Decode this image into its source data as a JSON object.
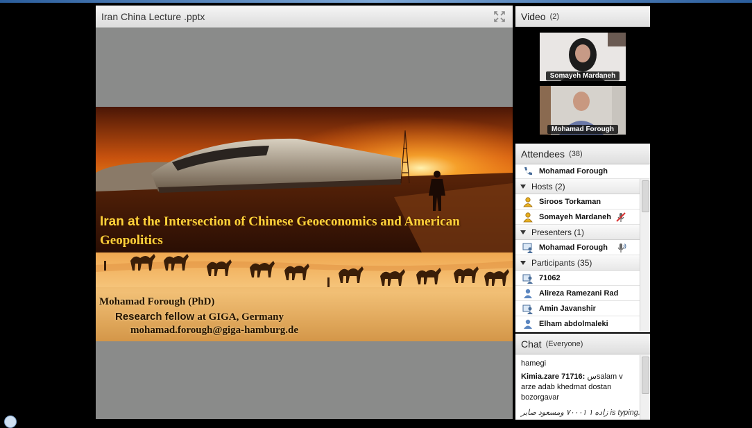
{
  "share": {
    "title": "Iran China Lecture .pptx",
    "slide": {
      "title_lead": "Iran at",
      "title_rest": "the Intersection of Chinese Geoeconomics and American Geopolitics",
      "author_name": "Mohamad Forough (PhD)",
      "author_role_lead": "Research fellow",
      "author_role_rest": "at GIGA, Germany",
      "author_email": "mohamad.forough@giga-hamburg.de"
    }
  },
  "video": {
    "title": "Video",
    "count": "(2)",
    "participants": [
      {
        "name": "Somayeh Mardaneh"
      },
      {
        "name": "Mohamad Forough"
      }
    ]
  },
  "attendees": {
    "title": "Attendees",
    "count": "(38)",
    "self": {
      "name": "Mohamad Forough",
      "icon": "phone-icon"
    },
    "hosts_label": "Hosts (2)",
    "hosts": [
      {
        "name": "Siroos Torkaman",
        "icon": "host-user-icon"
      },
      {
        "name": "Somayeh Mardaneh",
        "icon": "host-user-icon",
        "status_icon": "mic-muted-icon"
      }
    ],
    "presenters_label": "Presenters (1)",
    "presenters": [
      {
        "name": "Mohamad Forough",
        "icon": "presenter-icon",
        "status_icon": "mic-active-icon"
      }
    ],
    "participants_label": "Participants (35)",
    "participants": [
      {
        "name": "71062",
        "icon": "participant-video-icon"
      },
      {
        "name": "Alireza Ramezani Rad",
        "icon": "participant-icon"
      },
      {
        "name": "Amin Javanshir",
        "icon": "participant-video-icon"
      },
      {
        "name": "Elham abdolmaleki",
        "icon": "participant-icon"
      }
    ]
  },
  "chat": {
    "title": "Chat",
    "scope": "(Everyone)",
    "messages": [
      {
        "text": "hamegi"
      },
      {
        "sender": "Kimia.zare 71716:",
        "text": "سsalam v arze adab khedmat dostan bozorgavar"
      }
    ],
    "typing": "زاده ۱ ۷۰۰۰۱ ومسعود صابر is typing..."
  },
  "colors": {
    "accent": "#2a5d9c",
    "slide_title": "#ffd23a",
    "host_icon": "#e8b020",
    "muted_red": "#d83030"
  }
}
